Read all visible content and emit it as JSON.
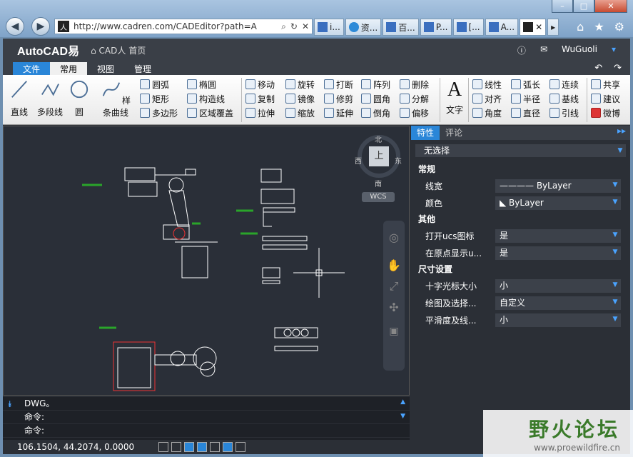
{
  "browser": {
    "url": "http://www.cadren.com/CADEditor?path=A",
    "tabs": [
      {
        "label": "i..."
      },
      {
        "label": "资..."
      },
      {
        "label": "百..."
      },
      {
        "label": "P..."
      },
      {
        "label": "[..."
      },
      {
        "label": "A..."
      }
    ]
  },
  "app": {
    "title": "AutoCAD易",
    "home_label": "CAD人 首页",
    "user": "WuGuoli",
    "menus": [
      "文件",
      "常用",
      "视图",
      "管理"
    ]
  },
  "ribbon": {
    "draw_big": [
      "直线",
      "多段线",
      "圆",
      "样条曲线"
    ],
    "draw_small": [
      "圆弧",
      "椭圆",
      "矩形",
      "构造线",
      "多边形",
      "区域覆盖"
    ],
    "modify": [
      "移动",
      "旋转",
      "打断",
      "阵列",
      "删除",
      "复制",
      "镜像",
      "修剪",
      "圆角",
      "分解",
      "拉伸",
      "缩放",
      "延伸",
      "倒角",
      "偏移"
    ],
    "text": "文字",
    "dim": [
      "线性",
      "弧长",
      "连续",
      "对齐",
      "半径",
      "基线",
      "角度",
      "直径",
      "引线"
    ],
    "share": [
      "共享",
      "建议",
      "微博"
    ]
  },
  "viewcube": {
    "north": "北",
    "south": "南",
    "east": "东",
    "west": "西",
    "top": "上",
    "wcs": "WCS"
  },
  "command": {
    "lines": [
      "DWG。",
      "命令:",
      "命令:"
    ]
  },
  "status": {
    "coords": "106.1504, 44.2074, 0.0000"
  },
  "panel": {
    "tabs": [
      "特性",
      "评论"
    ],
    "selection": "无选择",
    "sections": [
      {
        "title": "常规",
        "rows": [
          {
            "label": "线宽",
            "value": "ByLayer"
          },
          {
            "label": "颜色",
            "value": "ByLayer"
          }
        ]
      },
      {
        "title": "其他",
        "rows": [
          {
            "label": "打开ucs图标",
            "value": "是"
          },
          {
            "label": "在原点显示u...",
            "value": "是"
          }
        ]
      },
      {
        "title": "尺寸设置",
        "rows": [
          {
            "label": "十字光标大小",
            "value": "小"
          },
          {
            "label": "绘图及选择...",
            "value": "自定义"
          },
          {
            "label": "平滑度及线...",
            "value": "小"
          }
        ]
      }
    ]
  },
  "watermark": {
    "title": "野火论坛",
    "url": "www.proewildfire.cn"
  }
}
